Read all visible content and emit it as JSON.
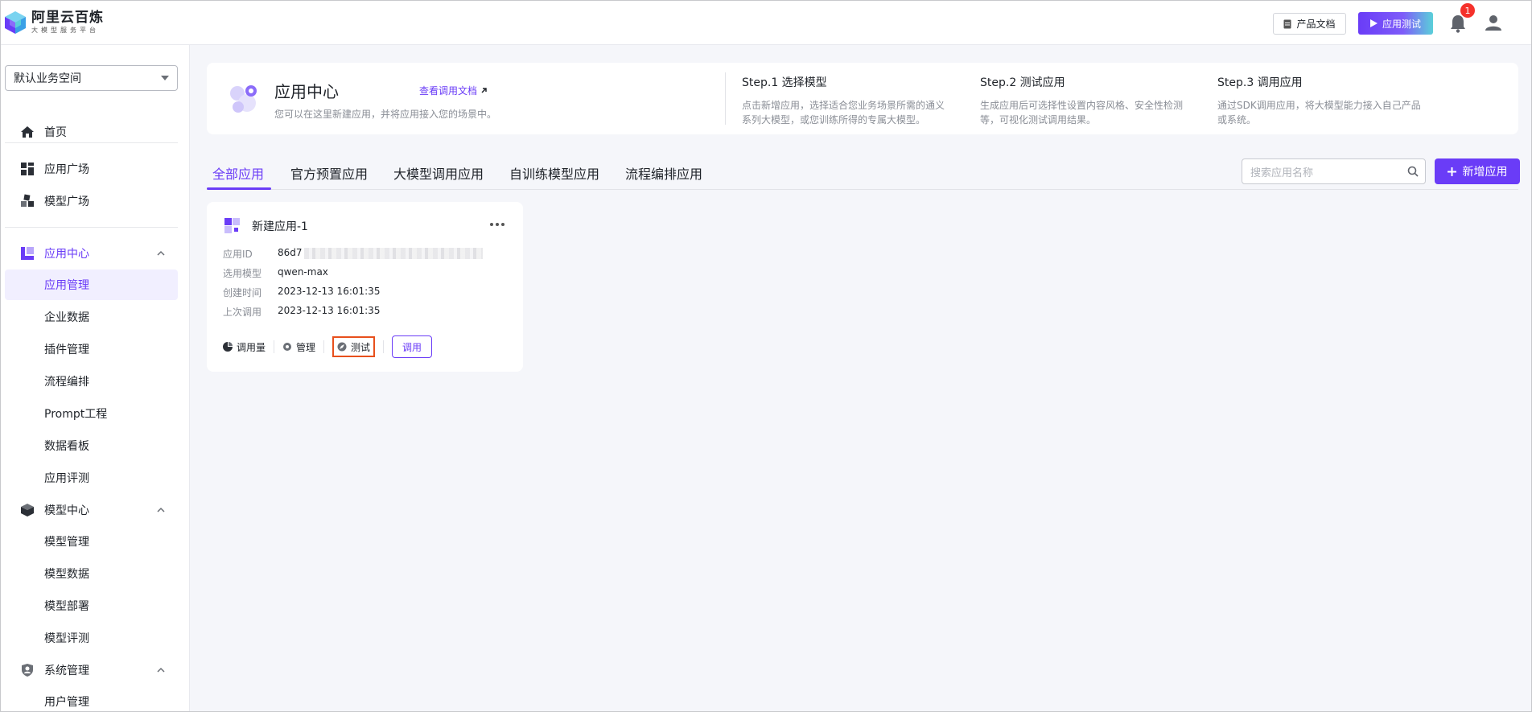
{
  "brand": {
    "title": "阿里云百炼",
    "subtitle": "大模型服务平台"
  },
  "header": {
    "doc_label": "产品文档",
    "test_label": "应用测试",
    "notification_count": "1",
    "accent_color": "#6a3cf7"
  },
  "sidebar": {
    "workspace": "默认业务空间",
    "home": "首页",
    "app_square": "应用广场",
    "model_square": "模型广场",
    "app_center": {
      "label": "应用中心",
      "items": [
        "应用管理",
        "企业数据",
        "插件管理",
        "流程编排",
        "Prompt工程",
        "数据看板",
        "应用评测"
      ]
    },
    "model_center": {
      "label": "模型中心",
      "items": [
        "模型管理",
        "模型数据",
        "模型部署",
        "模型评测"
      ]
    },
    "system": {
      "label": "系统管理",
      "items": [
        "用户管理"
      ]
    }
  },
  "intro": {
    "title": "应用中心",
    "desc": "您可以在这里新建应用，并将应用接入您的场景中。",
    "doc_link": "查看调用文档",
    "steps": [
      {
        "title": "Step.1 选择模型",
        "desc_line1": "点击新增应用，选择适合您业务场景所需的通义",
        "desc_line2": "系列大模型，或您训练所得的专属大模型。"
      },
      {
        "title": "Step.2 测试应用",
        "desc_line1": "生成应用后可选择性设置内容风格、安全性检测",
        "desc_line2": "等，可视化测试调用结果。"
      },
      {
        "title": "Step.3 调用应用",
        "desc_line1": "通过SDK调用应用，将大模型能力接入自己产品",
        "desc_line2": "或系统。"
      }
    ]
  },
  "tabs": [
    "全部应用",
    "官方预置应用",
    "大模型调用应用",
    "自训练模型应用",
    "流程编排应用"
  ],
  "search": {
    "placeholder": "搜索应用名称"
  },
  "add_button": "新增应用",
  "app_card": {
    "name": "新建应用-1",
    "id_label": "应用ID",
    "id_value": "86d7",
    "model_label": "选用模型",
    "model_value": "qwen-max",
    "created_label": "创建时间",
    "created_value": "2023-12-13 16:01:35",
    "last_call_label": "上次调用",
    "last_call_value": "2023-12-13 16:01:35",
    "actions": {
      "usage": "调用量",
      "manage": "管理",
      "test": "测试",
      "call": "调用"
    }
  }
}
